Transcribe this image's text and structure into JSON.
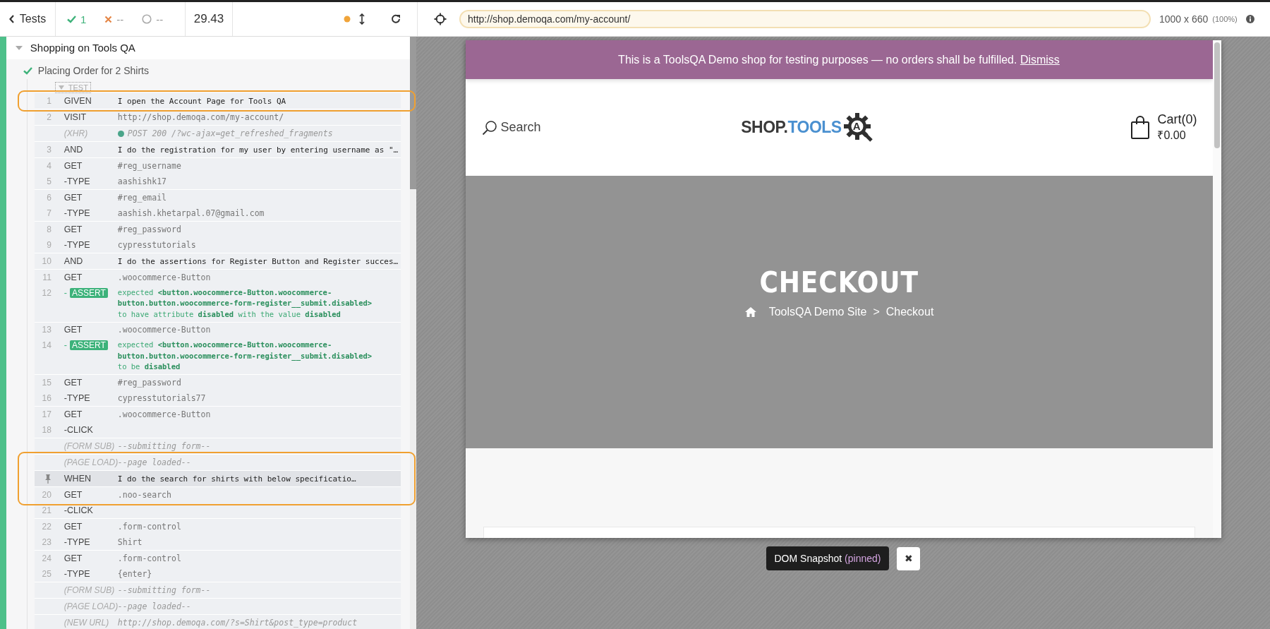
{
  "toolbar": {
    "back": "Tests",
    "passed": "1",
    "failed": "--",
    "pending": "--",
    "duration": "29.43",
    "url": "http://shop.demoqa.com/my-account/",
    "viewport": "1000 x 660",
    "scale": "(100%)"
  },
  "suite": {
    "title": "Shopping on Tools QA",
    "expanded": true,
    "test": {
      "title": "Placing Order for 2 Shirts",
      "passed": true,
      "section": "TEST",
      "groups": [
        {
          "rows": [
            {
              "number": "1",
              "name": "GIVEN",
              "message": "I open the Account Page for Tools QA",
              "kind": "step",
              "outlined": true
            }
          ]
        },
        {
          "rows": [
            {
              "number": "2",
              "name": "VISIT",
              "message": "http://shop.demoqa.com/my-account/",
              "kind": "command",
              "outlined": false
            }
          ]
        },
        {
          "rows": [
            {
              "name": "(XHR)",
              "message": "POST 200 /?wc-ajax=get_refreshed_fragments",
              "kind": "event",
              "color": "#4aa58a",
              "outlined": false
            }
          ]
        },
        {
          "rows": [
            {
              "number": "3",
              "name": "AND",
              "message": "I do the registration for my user by entering username as \"…",
              "kind": "step",
              "outlined": false
            }
          ]
        },
        {
          "rows": [
            {
              "number": "4",
              "name": "GET",
              "message": "#reg_username",
              "kind": "command",
              "outlined": false
            },
            {
              "number": "5",
              "name": "-TYPE",
              "message": "aashishk17",
              "kind": "command",
              "outlined": false
            }
          ]
        },
        {
          "rows": [
            {
              "number": "6",
              "name": "GET",
              "message": "#reg_email",
              "kind": "command",
              "outlined": false
            },
            {
              "number": "7",
              "name": "-TYPE",
              "message": "aashish.khetarpal.07@gmail.com",
              "kind": "command",
              "outlined": false
            }
          ]
        },
        {
          "rows": [
            {
              "number": "8",
              "name": "GET",
              "message": "#reg_password",
              "kind": "command",
              "outlined": false
            },
            {
              "number": "9",
              "name": "-TYPE",
              "message": "cypresstutorials",
              "kind": "command",
              "outlined": false
            }
          ]
        },
        {
          "rows": [
            {
              "number": "10",
              "name": "AND",
              "message": "I do the assertions for Register Button and Register succes…",
              "kind": "step",
              "outlined": false
            }
          ]
        },
        {
          "rows": [
            {
              "number": "11",
              "name": "GET",
              "message": ".woocommerce-Button",
              "kind": "command",
              "outlined": false
            },
            {
              "number": "12",
              "prefix": "-",
              "name": "ASSERT",
              "message": "expected **<button.woocommerce-Button.woocommerce-button.button.woocommerce-form-register__submit.disabled>** to have attribute **disabled** with the value **disabled**",
              "kind": "assert",
              "outlined": false
            }
          ]
        },
        {
          "rows": [
            {
              "number": "13",
              "name": "GET",
              "message": ".woocommerce-Button",
              "kind": "command",
              "outlined": false
            },
            {
              "number": "14",
              "prefix": "-",
              "name": "ASSERT",
              "message": "expected **<button.woocommerce-Button.woocommerce-button.button.woocommerce-form-register__submit.disabled>** to be **disabled**",
              "kind": "assert",
              "outlined": false
            }
          ]
        },
        {
          "rows": [
            {
              "number": "15",
              "name": "GET",
              "message": "#reg_password",
              "kind": "command",
              "outlined": false
            },
            {
              "number": "16",
              "name": "-TYPE",
              "message": "cypresstutorials77",
              "kind": "command",
              "outlined": false
            }
          ]
        },
        {
          "rows": [
            {
              "number": "17",
              "name": "GET",
              "message": ".woocommerce-Button",
              "kind": "command",
              "outlined": false
            },
            {
              "number": "18",
              "name": "-CLICK",
              "kind": "command",
              "outlined": false
            }
          ]
        },
        {
          "rows": [
            {
              "name": "(FORM SUB)",
              "message": "--submitting form--",
              "kind": "event",
              "outlined": false
            }
          ]
        },
        {
          "rows": [
            {
              "name": "(PAGE LOAD)",
              "message": "--page loaded--",
              "kind": "event",
              "outlined": true
            }
          ]
        },
        {
          "rows": [
            {
              "name": "WHEN",
              "message": "I do the search for shirts with below specificatio…",
              "kind": "step",
              "pinned": true,
              "outlined": true
            }
          ]
        },
        {
          "rows": [
            {
              "number": "20",
              "name": "GET",
              "message": ".noo-search",
              "kind": "command",
              "outlined": true
            },
            {
              "number": "21",
              "name": "-CLICK",
              "kind": "command",
              "outlined": false
            }
          ]
        },
        {
          "rows": [
            {
              "number": "22",
              "name": "GET",
              "message": ".form-control",
              "kind": "command",
              "outlined": false
            },
            {
              "number": "23",
              "name": "-TYPE",
              "message": "Shirt",
              "kind": "command",
              "outlined": false
            }
          ]
        },
        {
          "rows": [
            {
              "number": "24",
              "name": "GET",
              "message": ".form-control",
              "kind": "command",
              "outlined": false
            },
            {
              "number": "25",
              "name": "-TYPE",
              "message": "{enter}",
              "kind": "command",
              "outlined": false
            }
          ]
        },
        {
          "rows": [
            {
              "name": "(FORM SUB)",
              "message": "--submitting form--",
              "kind": "event",
              "outlined": false
            }
          ]
        },
        {
          "rows": [
            {
              "name": "(PAGE LOAD)",
              "message": "--page loaded--",
              "kind": "event",
              "outlined": false
            }
          ]
        },
        {
          "rows": [
            {
              "name": "(NEW URL)",
              "message": "http://shop.demoqa.com/?s=Shirt&post_type=product",
              "kind": "event",
              "outlined": false
            }
          ]
        }
      ]
    }
  },
  "app": {
    "banner": {
      "text": "This is a ToolsQA Demo shop for testing purposes — no orders shall be fulfilled.",
      "link": "Dismiss"
    },
    "header": {
      "search": "Search",
      "logo_dark": "SHOP.",
      "logo_blue": "TOOLS",
      "logo_mark": "A",
      "cart": "Cart(0)",
      "total": "₹0.00"
    },
    "hero": {
      "title": "CHECKOUT",
      "crumbs": [
        "ToolsQA Demo Site",
        "Checkout"
      ],
      "separator": ">"
    }
  },
  "snapshot": {
    "label": "DOM Snapshot",
    "note": "(pinned)",
    "close": "✖"
  }
}
